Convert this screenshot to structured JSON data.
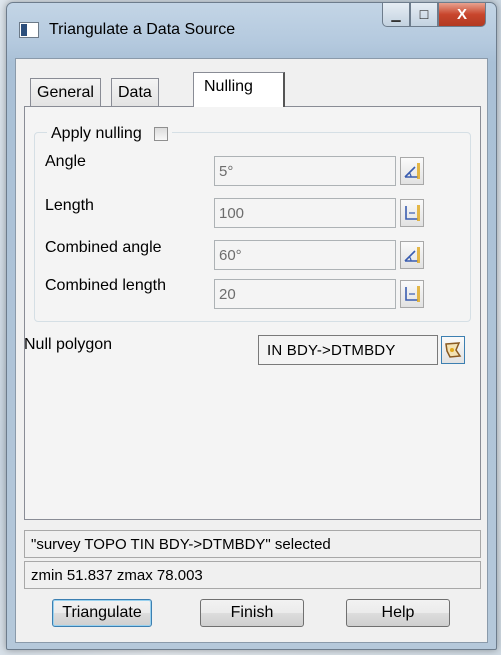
{
  "window": {
    "title": "Triangulate a Data Source",
    "minimize_glyph": "▁",
    "maximize_glyph": "☐",
    "close_glyph": "X"
  },
  "tabs": [
    {
      "label": "General",
      "active": false
    },
    {
      "label": "Data",
      "active": false
    },
    {
      "label": "Nulling",
      "active": true
    }
  ],
  "nulling": {
    "apply_label": "Apply nulling",
    "apply_checked": false,
    "angle": {
      "label": "Angle",
      "value": "5°",
      "button_icon": "angle-pick-icon"
    },
    "length": {
      "label": "Length",
      "value": "100",
      "button_icon": "length-pick-icon"
    },
    "combined_angle": {
      "label": "Combined angle",
      "value": "60°",
      "button_icon": "angle-pick-icon"
    },
    "combined_length": {
      "label": "Combined length",
      "value": "20",
      "button_icon": "length-pick-icon"
    }
  },
  "null_polygon": {
    "label": "Null polygon",
    "value": "IN BDY->DTMBDY",
    "button_icon": "polygon-pick-icon"
  },
  "status": {
    "line1": "\"survey TOPO TIN BDY->DTMBDY\" selected",
    "line2": "zmin 51.837 zmax 78.003"
  },
  "buttons": {
    "triangulate": "Triangulate",
    "finish": "Finish",
    "help": "Help"
  },
  "colors": {
    "close_button": "#c8452c",
    "frame": "#b4c9de",
    "icon_accent": "#e0a81c"
  }
}
